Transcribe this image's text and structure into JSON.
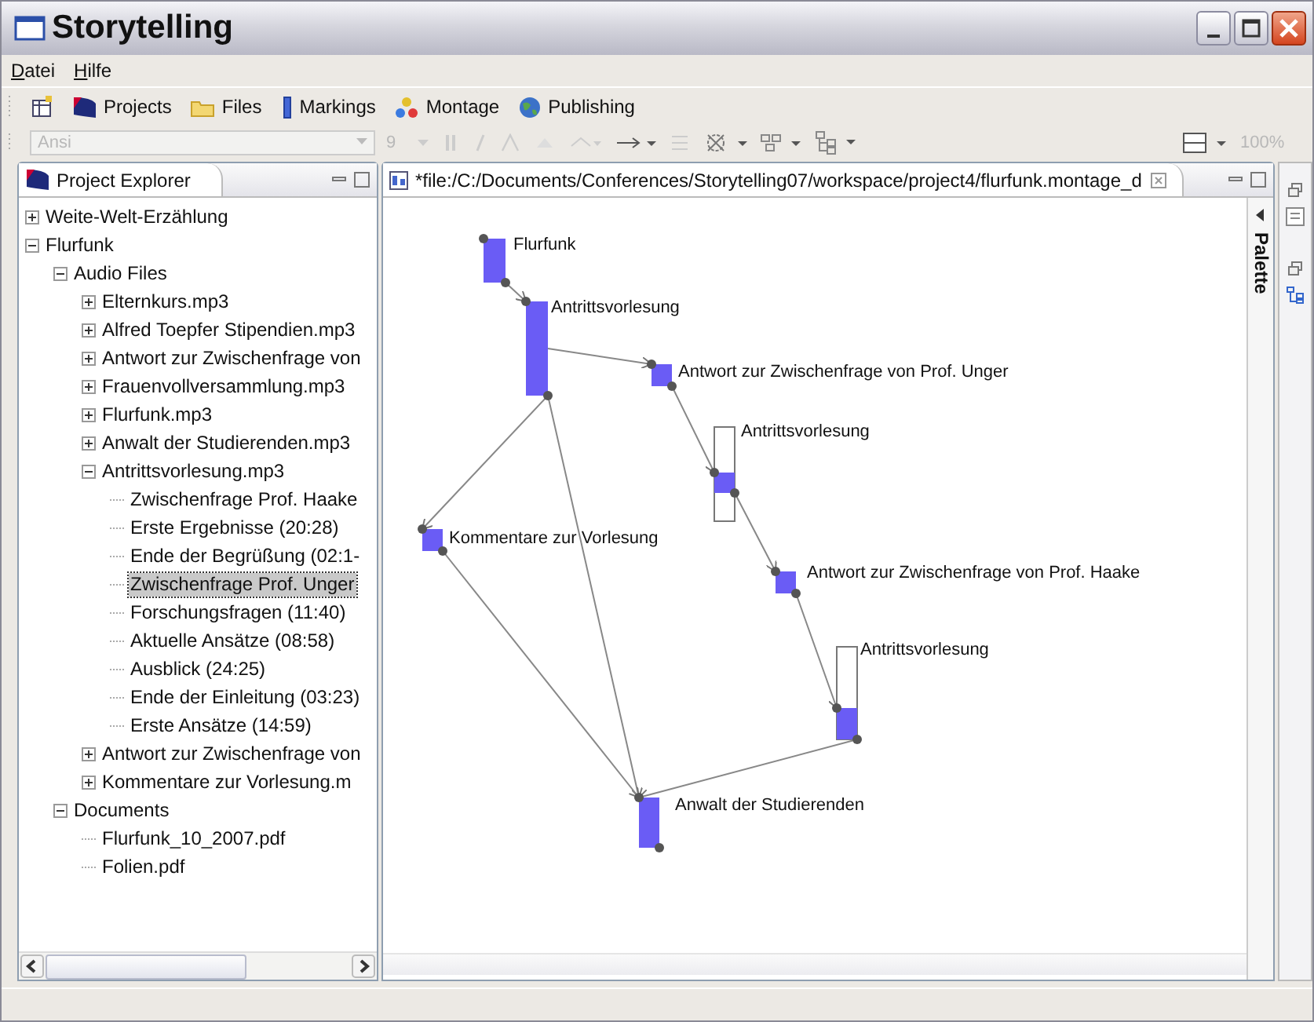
{
  "window": {
    "title": "Storytelling"
  },
  "menu": [
    "Datei",
    "Hilfe"
  ],
  "perspectives": [
    {
      "label": "Projects"
    },
    {
      "label": "Files"
    },
    {
      "label": "Markings"
    },
    {
      "label": "Montage"
    },
    {
      "label": "Publishing"
    }
  ],
  "format_bar": {
    "font": {
      "value": "Ansi",
      "disabled": true
    },
    "size": {
      "value": "9",
      "disabled": true
    },
    "zoom": {
      "value": "100%",
      "disabled": true
    }
  },
  "explorer": {
    "title": "Project Explorer",
    "tree": [
      {
        "label": "Weite-Welt-Erzählung",
        "expanded": false,
        "selected": false
      },
      {
        "label": "Flurfunk",
        "expanded": true,
        "selected": false,
        "children": [
          {
            "label": "Audio Files",
            "expanded": true,
            "selected": false,
            "children": [
              {
                "label": "Elternkurs.mp3",
                "expanded": false,
                "selected": false
              },
              {
                "label": "Alfred Toepfer Stipendien.mp3",
                "expanded": false,
                "selected": false
              },
              {
                "label": "Antwort zur Zwischenfrage von",
                "expanded": false,
                "selected": false
              },
              {
                "label": "Frauenvollversammlung.mp3",
                "expanded": false,
                "selected": false
              },
              {
                "label": "Flurfunk.mp3",
                "expanded": false,
                "selected": false
              },
              {
                "label": "Anwalt der Studierenden.mp3",
                "expanded": false,
                "selected": false
              },
              {
                "label": "Antrittsvorlesung.mp3",
                "expanded": true,
                "selected": false,
                "children": [
                  {
                    "label": "Zwischenfrage Prof. Haake",
                    "selected": false
                  },
                  {
                    "label": "Erste Ergebnisse (20:28)",
                    "selected": false
                  },
                  {
                    "label": "Ende der Begrüßung (02:1-",
                    "selected": false
                  },
                  {
                    "label": "Zwischenfrage Prof. Unger",
                    "selected": true
                  },
                  {
                    "label": "Forschungsfragen (11:40)",
                    "selected": false
                  },
                  {
                    "label": "Aktuelle Ansätze (08:58)",
                    "selected": false
                  },
                  {
                    "label": "Ausblick (24:25)",
                    "selected": false
                  },
                  {
                    "label": "Ende der Einleitung (03:23)",
                    "selected": false
                  },
                  {
                    "label": "Erste Ansätze (14:59)",
                    "selected": false
                  }
                ]
              },
              {
                "label": "Antwort zur Zwischenfrage von",
                "expanded": false,
                "selected": false
              },
              {
                "label": "Kommentare zur Vorlesung.m",
                "expanded": false,
                "selected": false
              }
            ]
          },
          {
            "label": "Documents",
            "expanded": true,
            "selected": false,
            "children": [
              {
                "label": "Flurfunk_10_2007.pdf",
                "selected": false
              },
              {
                "label": "Folien.pdf",
                "selected": false
              }
            ]
          }
        ]
      }
    ]
  },
  "editor": {
    "tab": "*file:/C:/Documents/Conferences/Storytelling07/workspace/project4/flurfunk.montage_d",
    "palette": "Palette",
    "nodes": [
      {
        "label": "Flurfunk",
        "kind": "segment"
      },
      {
        "label": "Antrittsvorlesung",
        "kind": "segment"
      },
      {
        "label": "Antwort zur Zwischenfrage von Prof. Unger",
        "kind": "segment"
      },
      {
        "label": "Antrittsvorlesung",
        "kind": "excerpt"
      },
      {
        "label": "Kommentare zur Vorlesung",
        "kind": "segment"
      },
      {
        "label": "Antwort zur Zwischenfrage von Prof. Haake",
        "kind": "segment"
      },
      {
        "label": "Antrittsvorlesung",
        "kind": "excerpt"
      },
      {
        "label": "Anwalt der Studierenden",
        "kind": "segment"
      }
    ]
  }
}
